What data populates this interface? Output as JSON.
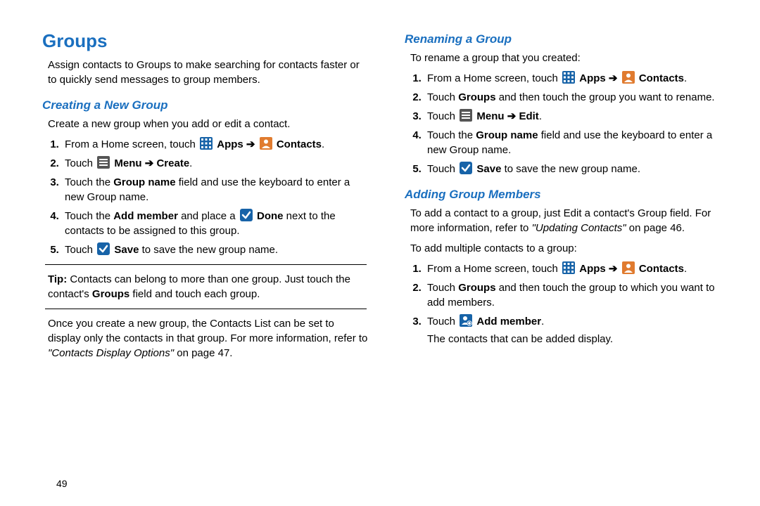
{
  "pageNumber": "49",
  "left": {
    "heading": "Groups",
    "intro": "Assign contacts to Groups to make searching for contacts faster or to quickly send messages to group members.",
    "subA": "Creating a New Group",
    "subA_intro": "Create a new group when you add or edit a contact.",
    "stepsA": {
      "s1_pre": "From a Home screen, touch ",
      "s1_apps": "Apps",
      "s1_contacts": "Contacts",
      "s1_post": ".",
      "s2_pre": "Touch ",
      "s2_menu": "Menu",
      "s2_create": "Create",
      "s2_post": ".",
      "s3_pre": "Touch the ",
      "s3_b": "Group name",
      "s3_post": " field and use the keyboard to enter a new Group name.",
      "s4_pre": "Touch the ",
      "s4_b1": "Add member",
      "s4_mid": " and place a ",
      "s4_b2": "Done",
      "s4_post": " next to the contacts to be assigned to this group.",
      "s5_pre": "Touch ",
      "s5_b": "Save",
      "s5_post": " to save the new group name."
    },
    "tip_label": "Tip:",
    "tip_text": " Contacts can belong to more than one group. Just touch the contact's ",
    "tip_b": "Groups",
    "tip_text2": " field and touch each group.",
    "after_tip": "Once you create a new group, the Contacts List can be set to display only the contacts in that group. For more information, refer to ",
    "after_ref": "\"Contacts Display Options\"",
    "after_page": " on page 47."
  },
  "right": {
    "subB": "Renaming a Group",
    "subB_intro": "To rename a group that you created:",
    "stepsB": {
      "s1_pre": "From a Home screen, touch ",
      "s1_apps": "Apps",
      "s1_contacts": "Contacts",
      "s1_post": ".",
      "s2_pre": "Touch ",
      "s2_b": "Groups",
      "s2_post": " and then touch the group you want to rename.",
      "s3_pre": "Touch ",
      "s3_menu": "Menu",
      "s3_edit": "Edit",
      "s3_post": ".",
      "s4_pre": "Touch the ",
      "s4_b": "Group name",
      "s4_post": " field and use the keyboard to enter a new Group name.",
      "s5_pre": "Touch ",
      "s5_b": "Save",
      "s5_post": " to save the new group name."
    },
    "subC": "Adding Group Members",
    "subC_p1a": "To add a contact to a group, just Edit a contact's Group field. For more information, refer to ",
    "subC_ref": "\"Updating Contacts\"",
    "subC_p1b": " on page 46.",
    "subC_p2": "To add multiple contacts to a group:",
    "stepsC": {
      "s1_pre": "From a Home screen, touch ",
      "s1_apps": "Apps",
      "s1_contacts": "Contacts",
      "s1_post": ".",
      "s2_pre": "Touch ",
      "s2_b": "Groups",
      "s2_post": " and then touch the group to which you want to add members.",
      "s3_pre": "Touch ",
      "s3_b": "Add member",
      "s3_post": ".",
      "s3_line2": "The contacts that can be added display."
    }
  }
}
